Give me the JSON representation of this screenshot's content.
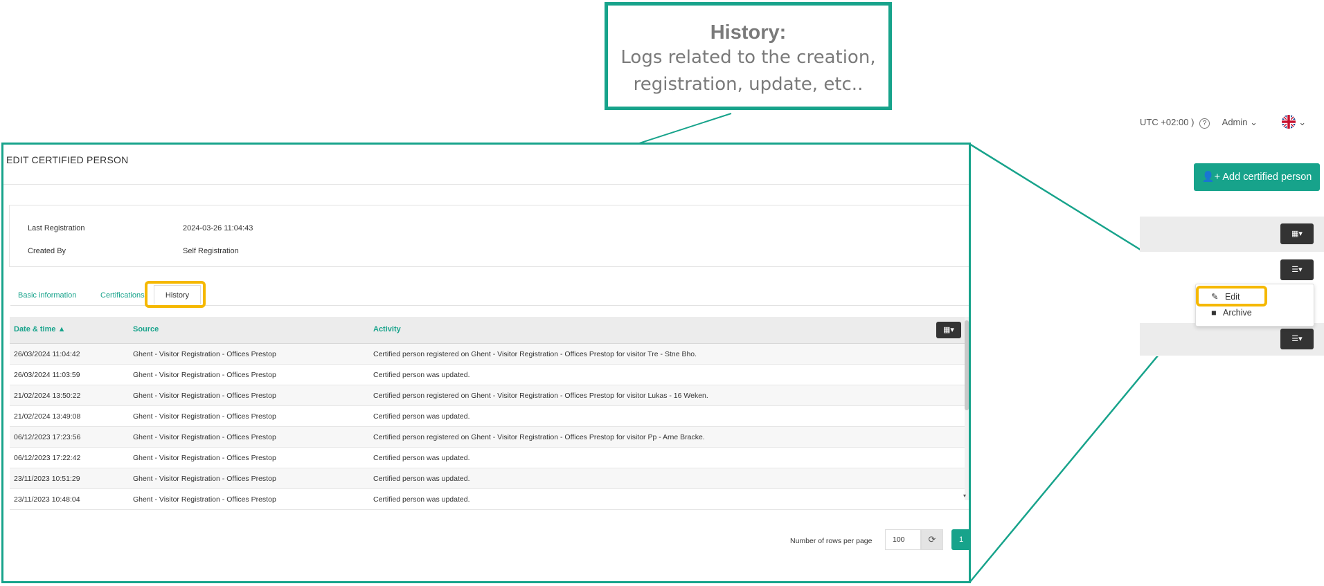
{
  "callout": {
    "title": "History:",
    "line1": "Logs related to the creation,",
    "line2": "registration, update, etc.."
  },
  "panel": {
    "header": "EDIT CERTIFIED PERSON",
    "info": [
      {
        "label": "Last Registration",
        "value": "2024-03-26 11:04:43"
      },
      {
        "label": "Created By",
        "value": "Self Registration"
      }
    ],
    "tabs": [
      "Basic information",
      "Certifications",
      "History"
    ],
    "active_tab": "History"
  },
  "table": {
    "columns": [
      "Date & time ▲",
      "Source",
      "Activity"
    ],
    "rows": [
      {
        "date": "26/03/2024 11:04:42",
        "source": "Ghent - Visitor Registration - Offices Prestop",
        "activity": "Certified person registered on Ghent - Visitor Registration - Offices Prestop for visitor Tre - Stne Bho."
      },
      {
        "date": "26/03/2024 11:03:59",
        "source": "Ghent - Visitor Registration - Offices Prestop",
        "activity": "Certified person was updated."
      },
      {
        "date": "21/02/2024 13:50:22",
        "source": "Ghent - Visitor Registration - Offices Prestop",
        "activity": "Certified person registered on Ghent - Visitor Registration - Offices Prestop for visitor Lukas - 16 Weken."
      },
      {
        "date": "21/02/2024 13:49:08",
        "source": "Ghent - Visitor Registration - Offices Prestop",
        "activity": "Certified person was updated."
      },
      {
        "date": "06/12/2023 17:23:56",
        "source": "Ghent - Visitor Registration - Offices Prestop",
        "activity": "Certified person registered on Ghent - Visitor Registration - Offices Prestop for visitor Pp - Arne Bracke."
      },
      {
        "date": "06/12/2023 17:22:42",
        "source": "Ghent - Visitor Registration - Offices Prestop",
        "activity": "Certified person was updated."
      },
      {
        "date": "23/11/2023 10:51:29",
        "source": "Ghent - Visitor Registration - Offices Prestop",
        "activity": "Certified person was updated."
      },
      {
        "date": "23/11/2023 10:48:04",
        "source": "Ghent - Visitor Registration - Offices Prestop",
        "activity": "Certified person was updated."
      }
    ]
  },
  "pagination": {
    "rows_label": "Number of rows per page",
    "rows_value": "100",
    "current_page": "1"
  },
  "topbar": {
    "timezone": "UTC +02:00 )",
    "user": "Admin",
    "language_icon": "uk-flag-icon"
  },
  "actions": {
    "add_label": "Add certified person",
    "menu": [
      "Edit",
      "Archive"
    ]
  },
  "colors": {
    "accent": "#17a38b",
    "highlight": "#f5b800",
    "dark_button": "#333333"
  }
}
